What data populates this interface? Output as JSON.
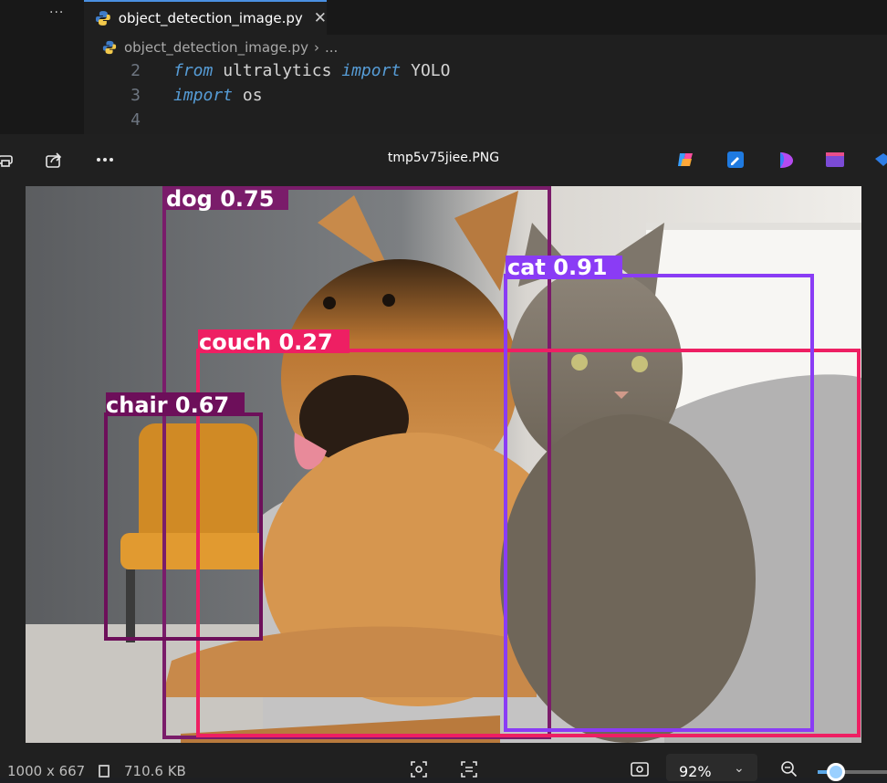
{
  "editor": {
    "more_label": "···",
    "tab_label": "object_detection_image.py",
    "tab_close": "✕",
    "breadcrumb_file": "object_detection_image.py",
    "breadcrumb_more": "...",
    "lines": [
      {
        "num": "2",
        "kw1": "from",
        "mid": " ultralytics ",
        "kw2": "import",
        "rest": " YOLO"
      },
      {
        "num": "3",
        "kw1": "import",
        "mid": " os",
        "kw2": "",
        "rest": ""
      },
      {
        "num": "4",
        "kw1": "",
        "mid": "",
        "kw2": "",
        "rest": ""
      }
    ]
  },
  "viewer": {
    "file_name": "tmp5v75jiee.PNG",
    "toolbar_icons": [
      "print-icon",
      "share-icon",
      "more-icon",
      "copilot-icon",
      "edit-icon",
      "designer-icon",
      "clipchamp-icon",
      "app-icon"
    ],
    "status": {
      "dimensions": "1000 x 667",
      "file_size": "710.6 KB",
      "zoom": "92%",
      "zoom_fraction": 0.22
    },
    "detections": [
      {
        "label": "dog 0.75",
        "color": "#7a1c6a"
      },
      {
        "label": "cat 0.91",
        "color": "#8a3cf5"
      },
      {
        "label": "couch 0.27",
        "color": "#ee1f63"
      },
      {
        "label": "chair 0.67",
        "color": "#6d0f5a"
      }
    ]
  }
}
